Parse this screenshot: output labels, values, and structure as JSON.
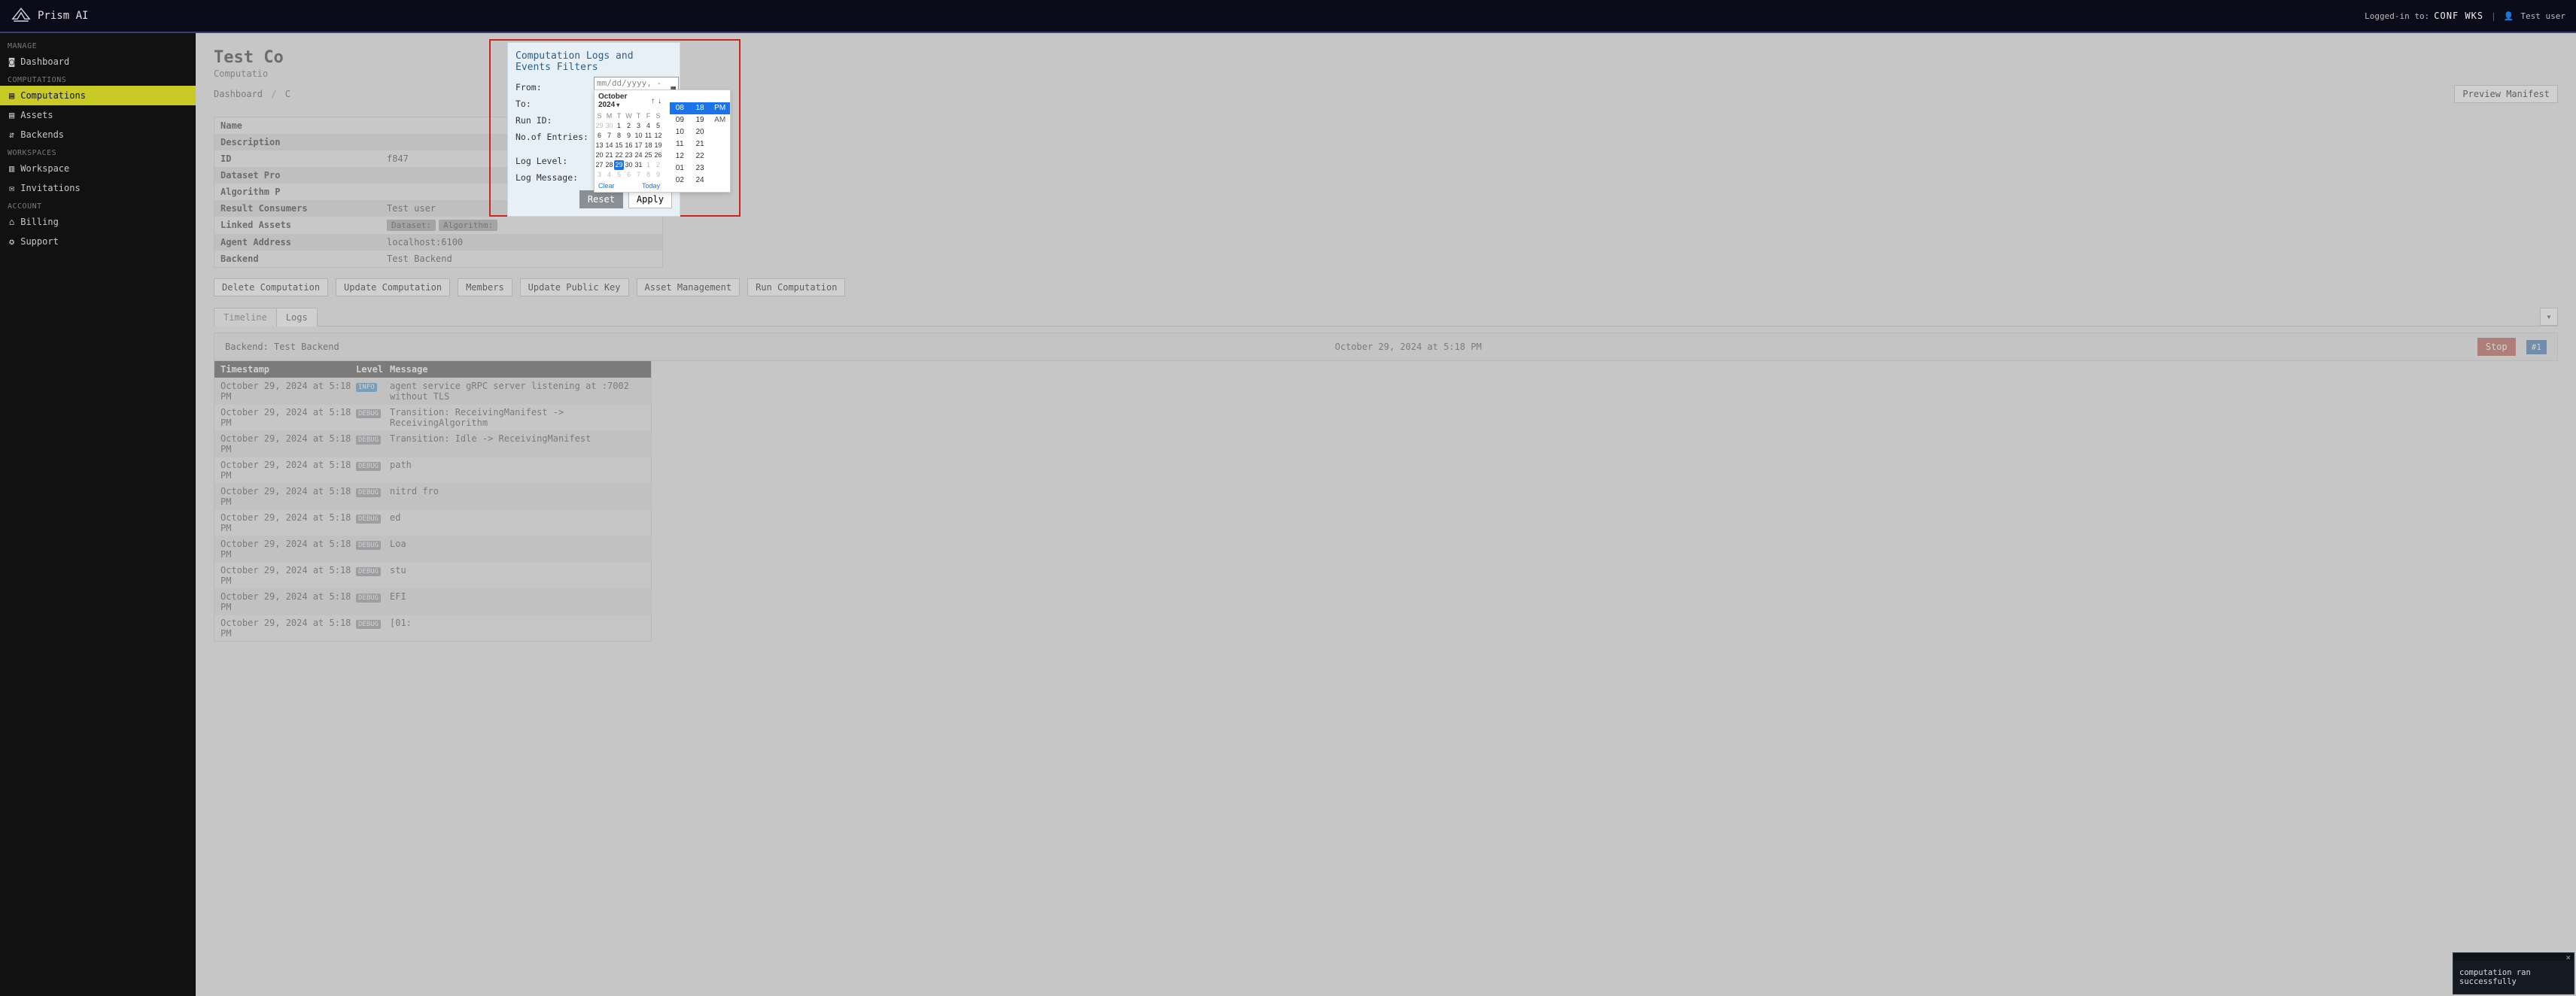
{
  "brand": "Prism AI",
  "auth": {
    "prefix": "Logged-in to:",
    "workspace": "CONF WKS",
    "user": "Test user"
  },
  "sidebar": {
    "groups": [
      {
        "title": "MANAGE",
        "items": [
          {
            "icon": "◙",
            "label": "Dashboard",
            "name": "sidebar-item-dashboard"
          }
        ]
      },
      {
        "title": "COMPUTATIONS",
        "items": [
          {
            "icon": "▤",
            "label": "Computations",
            "name": "sidebar-item-computations",
            "active": true
          },
          {
            "icon": "▤",
            "label": "Assets",
            "name": "sidebar-item-assets"
          },
          {
            "icon": "⇵",
            "label": "Backends",
            "name": "sidebar-item-backends"
          }
        ]
      },
      {
        "title": "WORKSPACES",
        "items": [
          {
            "icon": "▥",
            "label": "Workspace",
            "name": "sidebar-item-workspace"
          },
          {
            "icon": "✉",
            "label": "Invitations",
            "name": "sidebar-item-invitations"
          }
        ]
      },
      {
        "title": "ACCOUNT",
        "items": [
          {
            "icon": "⌂",
            "label": "Billing",
            "name": "sidebar-item-billing"
          },
          {
            "icon": "✪",
            "label": "Support",
            "name": "sidebar-item-support"
          }
        ]
      }
    ]
  },
  "page": {
    "title": "Test Co",
    "subtitle": "Computatio",
    "crumbs": [
      "Dashboard",
      "C"
    ],
    "preview_btn": "Preview Manifest"
  },
  "details": [
    {
      "k": "Name",
      "v": ""
    },
    {
      "k": "Description",
      "v": ""
    },
    {
      "k": "ID",
      "v": "f847"
    },
    {
      "k": "Dataset Pro",
      "v": ""
    },
    {
      "k": "Algorithm P",
      "v": ""
    },
    {
      "k": "Result Consumers",
      "v": "Test user"
    },
    {
      "k": "Linked Assets",
      "v": "__pills__"
    },
    {
      "k": "Agent Address",
      "v": "localhost:6100"
    },
    {
      "k": "Backend",
      "v": "Test Backend"
    }
  ],
  "linked_pills": [
    "Dataset:",
    "Algorithm:"
  ],
  "actions": [
    "Delete Computation",
    "Update Computation",
    "Members",
    "Update Public Key",
    "Asset Management",
    "Run Computation"
  ],
  "tabs": {
    "timeline": "Timeline",
    "logs": "Logs"
  },
  "backend_bar": {
    "label": "Backend: Test Backend",
    "time": "October 29, 2024 at 5:18 PM",
    "stop": "Stop",
    "tag": "#1"
  },
  "log_headers": {
    "ts": "Timestamp",
    "lvl": "Level",
    "msg": "Message"
  },
  "logs": [
    {
      "ts": "October 29, 2024 at 5:18 PM",
      "lvl": "INFO",
      "msg": "agent service gRPC server listening at :7002 without TLS"
    },
    {
      "ts": "October 29, 2024 at 5:18 PM",
      "lvl": "DEBUG",
      "msg": "Transition: ReceivingManifest -> ReceivingAlgorithm"
    },
    {
      "ts": "October 29, 2024 at 5:18 PM",
      "lvl": "DEBUG",
      "msg": "Transition: Idle -> ReceivingManifest"
    },
    {
      "ts": "October 29, 2024 at 5:18 PM",
      "lvl": "DEBUG",
      "msg": "path"
    },
    {
      "ts": "October 29, 2024 at 5:18 PM",
      "lvl": "DEBUG",
      "msg": "nitrd fro"
    },
    {
      "ts": "October 29, 2024 at 5:18 PM",
      "lvl": "DEBUG",
      "msg": "ed"
    },
    {
      "ts": "October 29, 2024 at 5:18 PM",
      "lvl": "DEBUG",
      "msg": "Loa"
    },
    {
      "ts": "October 29, 2024 at 5:18 PM",
      "lvl": "DEBUG",
      "msg": "stu"
    },
    {
      "ts": "October 29, 2024 at 5:18 PM",
      "lvl": "DEBUG",
      "msg": "EFI"
    },
    {
      "ts": "October 29, 2024 at 5:18 PM",
      "lvl": "DEBUG",
      "msg": "[01:"
    }
  ],
  "modal": {
    "title": "Computation Logs and Events Filters",
    "from": "From:",
    "to": "To:",
    "run": "Run ID:",
    "entries": "No.of Entries:",
    "level": "Log Level:",
    "msg": "Log Message:",
    "reset": "Reset",
    "apply": "Apply"
  },
  "dtfield": {
    "placeholder": "mm/dd/yyyy, --:-- --"
  },
  "datepicker": {
    "title": "October 2024",
    "weekdays": [
      "S",
      "M",
      "T",
      "W",
      "T",
      "F",
      "S"
    ],
    "rows": [
      [
        "29",
        "30",
        "1",
        "2",
        "3",
        "4",
        "5"
      ],
      [
        "6",
        "7",
        "8",
        "9",
        "10",
        "11",
        "12"
      ],
      [
        "13",
        "14",
        "15",
        "16",
        "17",
        "18",
        "19"
      ],
      [
        "20",
        "21",
        "22",
        "23",
        "24",
        "25",
        "26"
      ],
      [
        "27",
        "28",
        "29",
        "30",
        "31",
        "1",
        "2"
      ],
      [
        "3",
        "4",
        "5",
        "6",
        "7",
        "8",
        "9"
      ]
    ],
    "dim_rows": {
      "0": [
        0,
        1
      ],
      "4": [
        5,
        6
      ],
      "5": [
        0,
        1,
        2,
        3,
        4,
        5,
        6
      ]
    },
    "selected": {
      "row": 4,
      "col": 2
    },
    "clear": "Clear",
    "today": "Today",
    "hours": [
      "08",
      "09",
      "10",
      "11",
      "12",
      "01",
      "02"
    ],
    "mins": [
      "18",
      "19",
      "20",
      "21",
      "22",
      "23",
      "24"
    ],
    "ampm": [
      "PM",
      "AM"
    ]
  },
  "toast": {
    "msg": "computation ran successfully"
  }
}
